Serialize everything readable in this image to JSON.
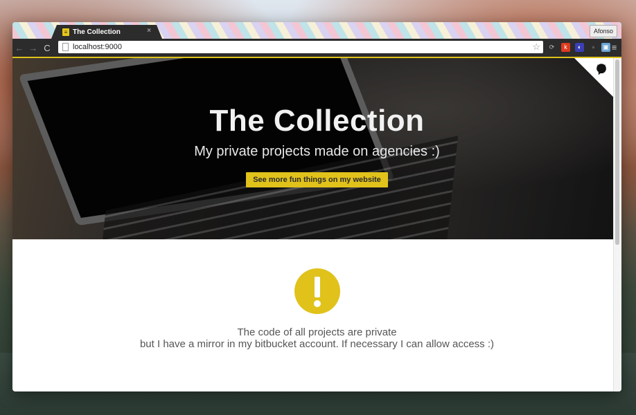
{
  "browser": {
    "tab_title": "The Collection",
    "tab_close": "×",
    "profile_name": "Afonso",
    "url": "localhost:9000",
    "nav": {
      "back": "←",
      "forward": "→",
      "reload": "C"
    },
    "star": "☆",
    "extensions": [
      {
        "name": "sync-icon",
        "label": "⟳",
        "color": "#2c2c2c"
      },
      {
        "name": "k-extension-icon",
        "label": "k",
        "color": "#e03a1e"
      },
      {
        "name": "globe-extension-icon",
        "label": "◐",
        "color": "#3a3fb5"
      },
      {
        "name": "shield-extension-icon",
        "label": "●",
        "color": "#3a3a3a"
      },
      {
        "name": "camera-extension-icon",
        "label": "▣",
        "color": "#6aa5d6"
      }
    ],
    "menu_icon": "≡"
  },
  "hero": {
    "title": "The Collection",
    "subtitle": "My private projects made on agencies :)",
    "cta_label": "See more fun things on my website"
  },
  "notice": {
    "line1": "The code of all projects are private",
    "line2": "but I have a mirror in my bitbucket account. If necessary I can allow access :)"
  },
  "colors": {
    "accent": "#e0c21b",
    "toolbar": "#2c2c2c"
  }
}
